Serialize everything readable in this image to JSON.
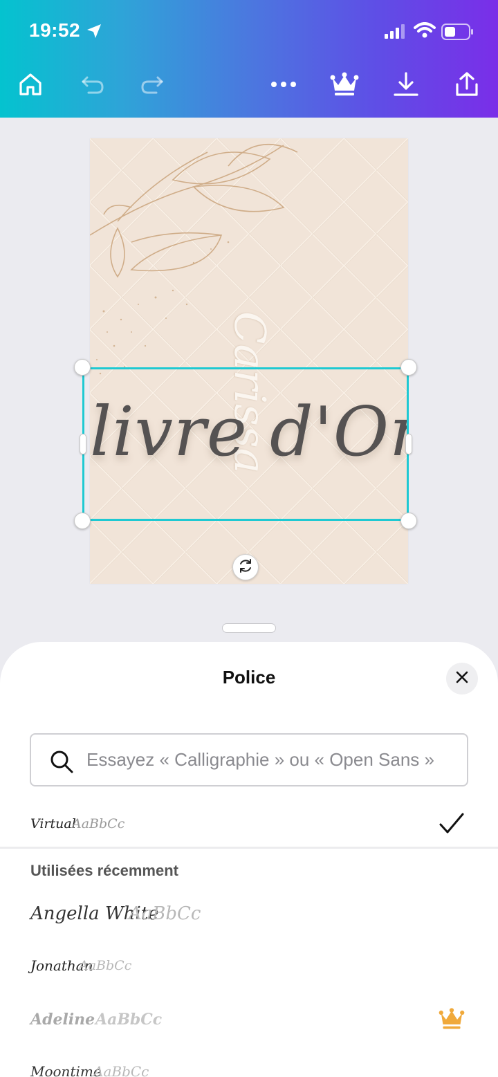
{
  "status": {
    "time": "19:52"
  },
  "toolbar": {
    "icons": [
      "home-icon",
      "undo-icon",
      "redo-icon",
      "more-icon",
      "crown-icon",
      "download-icon",
      "share-icon"
    ],
    "accent_start": "#04c3cf",
    "accent_end": "#7a2ee8"
  },
  "design": {
    "script_vertical": "Carissa",
    "title": "livre d'Or",
    "background_color": "#f1e4d8",
    "selection_color": "#1ec9d2"
  },
  "sheet": {
    "title": "Police",
    "search_placeholder": "Essayez « Calligraphie » ou « Open Sans »",
    "current_font": {
      "name": "Virtual",
      "sample": "AaBbCc",
      "selected": true
    },
    "recent_section_title": "Utilisées récemment",
    "recent_fonts": [
      {
        "name": "Angella White",
        "sample": "AaBbCc",
        "premium": false
      },
      {
        "name": "Jonathan",
        "sample": "AaBbCc",
        "premium": false
      },
      {
        "name": "Adeline",
        "sample": "AaBbCc",
        "premium": true
      },
      {
        "name": "Moontime",
        "sample": "AaBbCc",
        "premium": false
      }
    ],
    "premium_color": "#f0a93b"
  }
}
